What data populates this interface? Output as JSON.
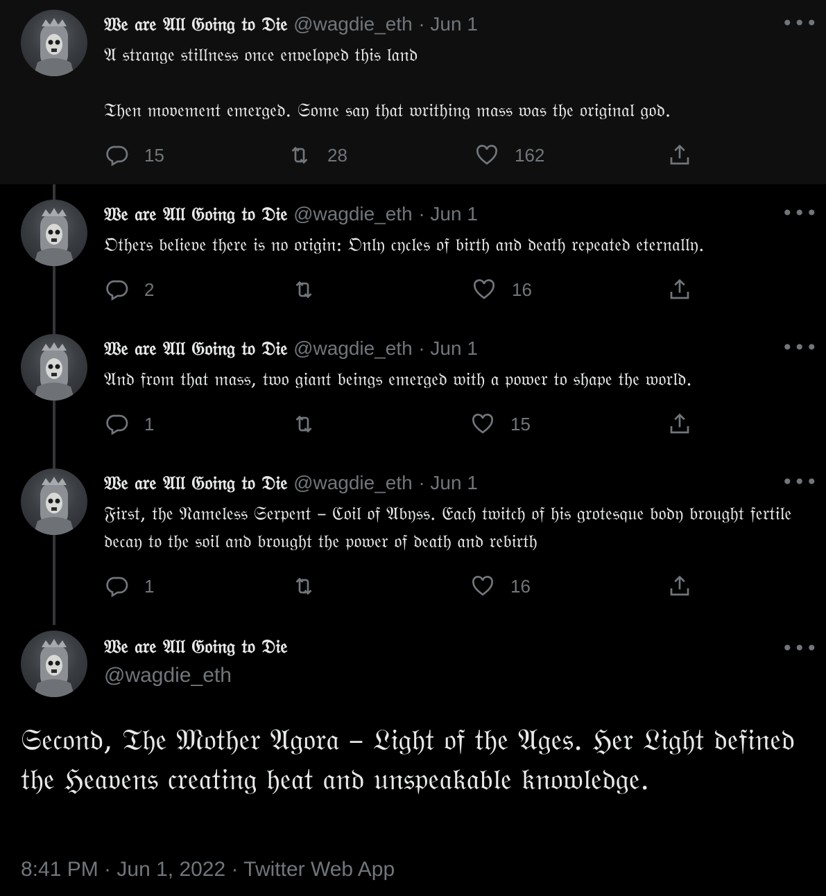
{
  "author": {
    "name": "𝔚𝔢 𝔞𝔯𝔢 𝔄𝔩𝔩 𝔊𝔬𝔦𝔫𝔤 𝔱𝔬 𝔇𝔦𝔢",
    "handle": "@wagdie_eth",
    "date_sep": "· Jun 1"
  },
  "more_label": "•••",
  "tweets": [
    {
      "text": "𝔄 𝔰𝔱𝔯𝔞𝔫𝔤𝔢 𝔰𝔱𝔦𝔩𝔩𝔫𝔢𝔰𝔰 𝔬𝔫𝔠𝔢 𝔢𝔫𝔳𝔢𝔩𝔬𝔭𝔢𝔡 𝔱𝔥𝔦𝔰 𝔩𝔞𝔫𝔡\n\n𝔗𝔥𝔢𝔫 𝔪𝔬𝔳𝔢𝔪𝔢𝔫𝔱 𝔢𝔪𝔢𝔯𝔤𝔢𝔡. 𝔖𝔬𝔪𝔢 𝔰𝔞𝔶 𝔱𝔥𝔞𝔱 𝔴𝔯𝔦𝔱𝔥𝔦𝔫𝔤 𝔪𝔞𝔰𝔰 𝔴𝔞𝔰 𝔱𝔥𝔢 𝔬𝔯𝔦𝔤𝔦𝔫𝔞𝔩 𝔤𝔬𝔡.",
      "replies": "15",
      "retweets": "28",
      "likes": "162"
    },
    {
      "text": "𝔒𝔱𝔥𝔢𝔯𝔰 𝔟𝔢𝔩𝔦𝔢𝔳𝔢 𝔱𝔥𝔢𝔯𝔢 𝔦𝔰 𝔫𝔬 𝔬𝔯𝔦𝔤𝔦𝔫: 𝔒𝔫𝔩𝔶 𝔠𝔶𝔠𝔩𝔢𝔰 𝔬𝔣 𝔟𝔦𝔯𝔱𝔥 𝔞𝔫𝔡 𝔡𝔢𝔞𝔱𝔥 𝔯𝔢𝔭𝔢𝔞𝔱𝔢𝔡 𝔢𝔱𝔢𝔯𝔫𝔞𝔩𝔩𝔶.",
      "replies": "2",
      "retweets": "",
      "likes": "16"
    },
    {
      "text": "𝔄𝔫𝔡 𝔣𝔯𝔬𝔪 𝔱𝔥𝔞𝔱 𝔪𝔞𝔰𝔰, 𝔱𝔴𝔬 𝔤𝔦𝔞𝔫𝔱 𝔟𝔢𝔦𝔫𝔤𝔰 𝔢𝔪𝔢𝔯𝔤𝔢𝔡 𝔴𝔦𝔱𝔥 𝔞 𝔭𝔬𝔴𝔢𝔯 𝔱𝔬 𝔰𝔥𝔞𝔭𝔢 𝔱𝔥𝔢 𝔴𝔬𝔯𝔩𝔡.",
      "replies": "1",
      "retweets": "",
      "likes": "15"
    },
    {
      "text": "𝔉𝔦𝔯𝔰𝔱, 𝔱𝔥𝔢 𝔑𝔞𝔪𝔢𝔩𝔢𝔰𝔰 𝔖𝔢𝔯𝔭𝔢𝔫𝔱 – ℭ𝔬𝔦𝔩 𝔬𝔣 𝔄𝔟𝔶𝔰𝔰. 𝔈𝔞𝔠𝔥 𝔱𝔴𝔦𝔱𝔠𝔥 𝔬𝔣 𝔥𝔦𝔰 𝔤𝔯𝔬𝔱𝔢𝔰𝔮𝔲𝔢 𝔟𝔬𝔡𝔶 𝔟𝔯𝔬𝔲𝔤𝔥𝔱 𝔣𝔢𝔯𝔱𝔦𝔩𝔢 𝔡𝔢𝔠𝔞𝔶 𝔱𝔬 𝔱𝔥𝔢 𝔰𝔬𝔦𝔩 𝔞𝔫𝔡 𝔟𝔯𝔬𝔲𝔤𝔥𝔱 𝔱𝔥𝔢 𝔭𝔬𝔴𝔢𝔯 𝔬𝔣 𝔡𝔢𝔞𝔱𝔥 𝔞𝔫𝔡 𝔯𝔢𝔟𝔦𝔯𝔱𝔥",
      "replies": "1",
      "retweets": "",
      "likes": "16"
    }
  ],
  "main_tweet": {
    "text": "𝔖𝔢𝔠𝔬𝔫𝔡, 𝔗𝔥𝔢 𝔐𝔬𝔱𝔥𝔢𝔯 𝔄𝔤𝔬𝔯𝔞 – 𝔏𝔦𝔤𝔥𝔱 𝔬𝔣 𝔱𝔥𝔢 𝔄𝔤𝔢𝔰. ℌ𝔢𝔯 𝔏𝔦𝔤𝔥𝔱 𝔡𝔢𝔣𝔦𝔫𝔢𝔡 𝔱𝔥𝔢 ℌ𝔢𝔞𝔳𝔢𝔫𝔰 𝔠𝔯𝔢𝔞𝔱𝔦𝔫𝔤 𝔥𝔢𝔞𝔱 𝔞𝔫𝔡 𝔲𝔫𝔰𝔭𝔢𝔞𝔨𝔞𝔟𝔩𝔢 𝔨𝔫𝔬𝔴𝔩𝔢𝔡𝔤𝔢.",
    "footer": "8:41 PM · Jun 1, 2022 · Twitter Web App"
  },
  "icons": {
    "reply": "reply-icon",
    "retweet": "retweet-icon",
    "like": "heart-icon",
    "share": "share-icon"
  },
  "colors": {
    "background": "#000000",
    "highlight_background": "#0f0f0f",
    "text": "#e7e9ea",
    "secondary": "#71767b",
    "thread_line": "#333639"
  }
}
